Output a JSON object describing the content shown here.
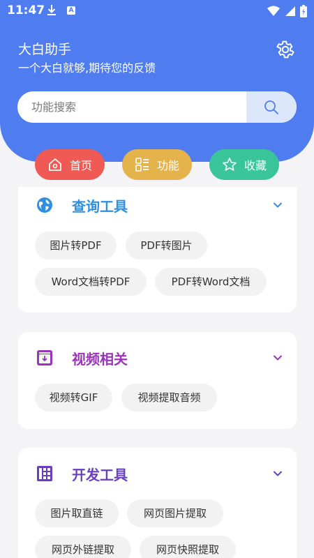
{
  "status_bar": {
    "time": "11:47",
    "a_badge": "A"
  },
  "header": {
    "title": "大白助手",
    "subtitle": "一个大白就够,期待您的反馈"
  },
  "search": {
    "placeholder": "功能搜索"
  },
  "nav": {
    "home": "首页",
    "functions": "功能",
    "favorites": "收藏"
  },
  "colors": {
    "header_blue": "#4f7df0",
    "home_red": "#ef5a55",
    "func_yellow": "#e4b34b",
    "fav_green": "#39c49a",
    "query_blue": "#2f8fe0",
    "video_purple": "#9b35b8",
    "dev_violet": "#6a3fbf"
  },
  "sections": [
    {
      "title": "查询工具",
      "icon": "globe-icon",
      "chips": [
        "图片转PDF",
        "PDF转图片",
        "Word文档转PDF",
        "PDF转Word文档"
      ]
    },
    {
      "title": "视频相关",
      "icon": "video-box-icon",
      "chips": [
        "视频转GIF",
        "视频提取音频"
      ]
    },
    {
      "title": "开发工具",
      "icon": "grid-panel-icon",
      "chips": [
        "图片取直链",
        "网页图片提取",
        "网页外链提取",
        "网页快照提取"
      ]
    }
  ]
}
